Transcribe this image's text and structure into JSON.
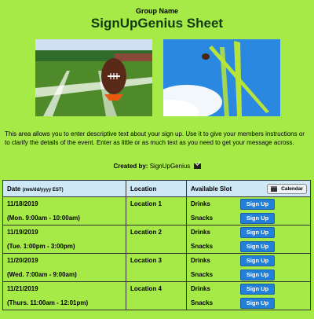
{
  "header": {
    "group_name": "Group Name",
    "title": "SignUpGenius Sheet"
  },
  "description": "This area allows you to enter descriptive text about your sign up. Use it to give your members instructions or to clarify the details of the event. Enter as little or as much text as you need to get your message across.",
  "created_by": {
    "label": "Created by:",
    "name": "SignUpGenius"
  },
  "table": {
    "headers": {
      "date": "Date",
      "date_format": "(mm/dd/yyyy EST)",
      "location": "Location",
      "slot": "Available Slot",
      "calendar_button": "Calendar"
    },
    "rows": [
      {
        "date": "11/18/2019",
        "time": "(Mon. 9:00am - 10:00am)",
        "location": "Location 1",
        "slots": [
          "Drinks",
          "Snacks"
        ]
      },
      {
        "date": "11/19/2019",
        "time": "(Tue. 1:00pm - 3:00pm)",
        "location": "Location 2",
        "slots": [
          "Drinks",
          "Snacks"
        ]
      },
      {
        "date": "11/20/2019",
        "time": "(Wed. 7:00am - 9:00am)",
        "location": "Location 3",
        "slots": [
          "Drinks",
          "Snacks"
        ]
      },
      {
        "date": "11/21/2019",
        "time": "(Thurs. 11:00am - 12:01pm)",
        "location": "Location 4",
        "slots": [
          "Drinks",
          "Snacks"
        ]
      }
    ],
    "signup_label": "Sign Up"
  },
  "colors": {
    "background": "#a6ea48",
    "title": "#143c14",
    "header_row": "#cfe8f6",
    "signup_button": "#2380d8"
  },
  "icons": {
    "email": "envelope-icon",
    "calendar": "calendar-icon"
  }
}
